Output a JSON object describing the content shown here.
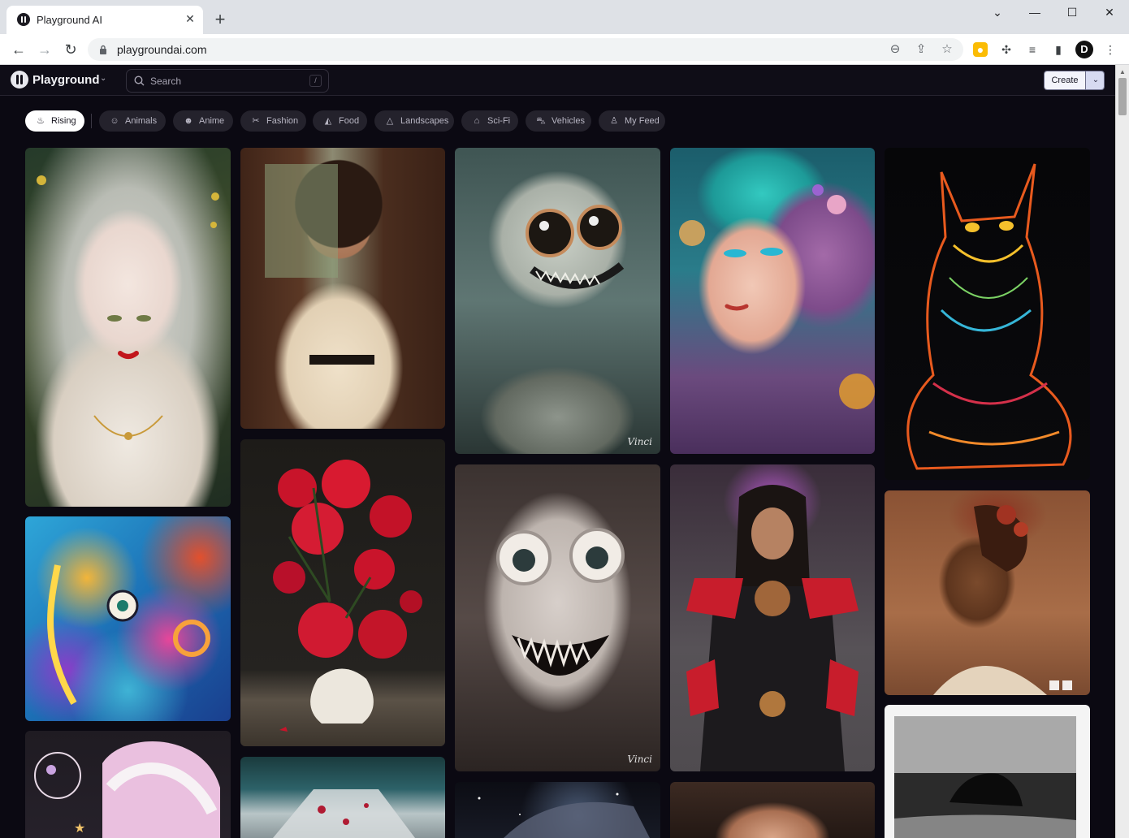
{
  "browser": {
    "tab_title": "Playground AI",
    "tab_close": "✕",
    "new_tab": "+",
    "url": "playgroundai.com",
    "profile_initial": "D"
  },
  "header": {
    "brand": "Playground",
    "search_placeholder": "Search",
    "search_shortcut": "/",
    "create_label": "Create"
  },
  "categories": [
    {
      "label": "Rising",
      "icon": "flame-icon",
      "active": true
    },
    {
      "label": "Animals",
      "icon": "animal-icon"
    },
    {
      "label": "Anime",
      "icon": "anime-icon"
    },
    {
      "label": "Fashion",
      "icon": "fashion-icon"
    },
    {
      "label": "Food",
      "icon": "food-icon"
    },
    {
      "label": "Landscapes",
      "icon": "mountain-icon"
    },
    {
      "label": "Sci-Fi",
      "icon": "rocket-icon"
    },
    {
      "label": "Vehicles",
      "icon": "car-icon"
    },
    {
      "label": "My Feed",
      "icon": "user-icon"
    }
  ],
  "images": [
    {
      "subject": "pale-haired girl with pearl necklace"
    },
    {
      "subject": "curly-haired woman in white dress"
    },
    {
      "subject": "furry grey creature on coin pile",
      "signature": "Vinci"
    },
    {
      "subject": "teal-haired woman with jewels"
    },
    {
      "subject": "neon line-art cat"
    },
    {
      "subject": "psychedelic face portrait"
    },
    {
      "subject": "red peonies in white vase"
    },
    {
      "subject": "smiling furry monster",
      "signature": "Vinci"
    },
    {
      "subject": "long-haired samurai warrior"
    },
    {
      "subject": "woman with roses in hair"
    },
    {
      "subject": "pink-haired girl with planets"
    },
    {
      "subject": "futuristic sci-fi portrait"
    },
    {
      "subject": "space fantasy scene"
    },
    {
      "subject": "woman portrait"
    },
    {
      "subject": "monochrome seascape with rock"
    }
  ]
}
